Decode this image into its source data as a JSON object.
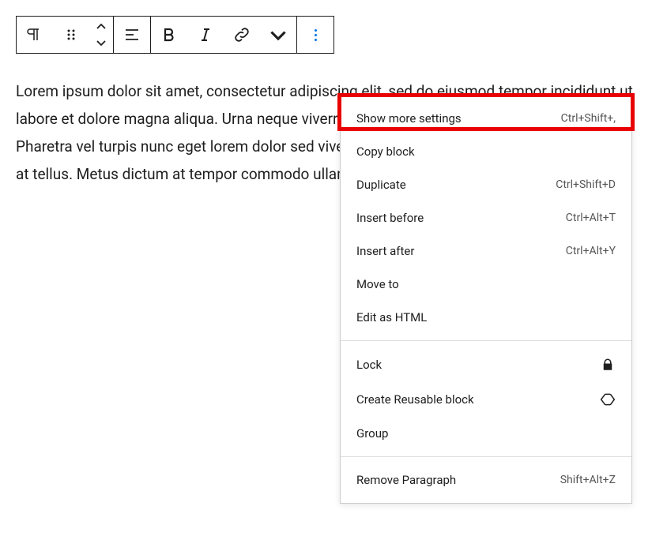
{
  "content": {
    "paragraph": "Lorem ipsum dolor sit amet, consectetur adipiscing elit, sed do eiusmod tempor incididunt ut labore et dolore magna aliqua. Urna neque viverra justo nec ultrices dui sapien eget mi. Pharetra vel turpis nunc eget lorem dolor sed viverra ipsum. At risus viverra semper eget duis at tellus. Metus dictum at tempor commodo ullamcorper a lacus."
  },
  "menu": {
    "section1": [
      {
        "label": "Show more settings",
        "shortcut": "Ctrl+Shift+,"
      },
      {
        "label": "Copy block",
        "shortcut": ""
      },
      {
        "label": "Duplicate",
        "shortcut": "Ctrl+Shift+D"
      },
      {
        "label": "Insert before",
        "shortcut": "Ctrl+Alt+T"
      },
      {
        "label": "Insert after",
        "shortcut": "Ctrl+Alt+Y"
      },
      {
        "label": "Move to",
        "shortcut": ""
      },
      {
        "label": "Edit as HTML",
        "shortcut": ""
      }
    ],
    "section2": [
      {
        "label": "Lock",
        "icon": "lock"
      },
      {
        "label": "Create Reusable block",
        "icon": "diamond"
      },
      {
        "label": "Group",
        "icon": ""
      }
    ],
    "section3": [
      {
        "label": "Remove Paragraph",
        "shortcut": "Shift+Alt+Z"
      }
    ]
  }
}
